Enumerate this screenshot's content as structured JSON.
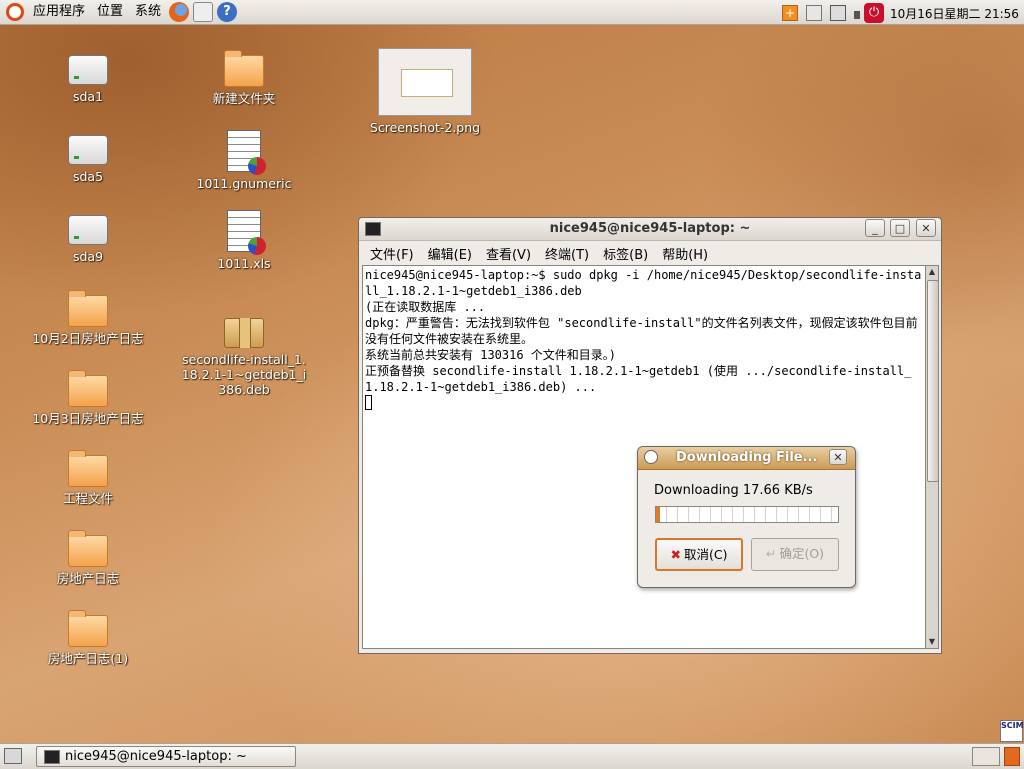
{
  "top_panel": {
    "menus": [
      "应用程序",
      "位置",
      "系统"
    ],
    "launchers": [
      "firefox-icon",
      "mail-icon",
      "help-icon"
    ],
    "tray_icons": [
      "notification-icon",
      "keyboard-icon",
      "network-icon",
      "volume-icon",
      "power-icon"
    ],
    "clock": "10月16日星期二 21:56"
  },
  "desktop": {
    "icons": [
      {
        "label": "sda1",
        "type": "drive"
      },
      {
        "label": "sda5",
        "type": "drive"
      },
      {
        "label": "sda9",
        "type": "drive"
      },
      {
        "label": "10月2日房地产日志",
        "type": "folder"
      },
      {
        "label": "10月3日房地产日志",
        "type": "folder"
      },
      {
        "label": "工程文件",
        "type": "folder"
      },
      {
        "label": "房地产日志",
        "type": "folder"
      },
      {
        "label": "房地产日志(1)",
        "type": "folder"
      },
      {
        "label": "新建文件夹",
        "type": "folder"
      },
      {
        "label": "1011.gnumeric",
        "type": "spreadsheet"
      },
      {
        "label": "1011.xls",
        "type": "spreadsheet"
      },
      {
        "label": "secondlife-install_1.18.2.1-1~getdeb1_i386.deb",
        "type": "package"
      },
      {
        "label": "Screenshot-2.png",
        "type": "image"
      }
    ]
  },
  "terminal": {
    "title": "nice945@nice945-laptop: ~",
    "menu": [
      "文件(F)",
      "编辑(E)",
      "查看(V)",
      "终端(T)",
      "标签(B)",
      "帮助(H)"
    ],
    "output": "nice945@nice945-laptop:~$ sudo dpkg -i /home/nice945/Desktop/secondlife-install_1.18.2.1-1~getdeb1_i386.deb\n(正在读取数据库 ...\ndpkg：严重警告：无法找到软件包 \"secondlife-install\"的文件名列表文件，现假定该软件包目前没有任何文件被安装在系统里。\n系统当前总共安装有 130316 个文件和目录。)\n正预备替换 secondlife-install 1.18.2.1-1~getdeb1 (使用 .../secondlife-install_1.18.2.1-1~getdeb1_i386.deb) ..."
  },
  "dialog": {
    "title": "Downloading File...",
    "status": "Downloading 17.66 KB/s",
    "progress_percent": 2,
    "cancel_label": "取消(C)",
    "ok_label": "确定(O)"
  },
  "bottom_panel": {
    "task_label": "nice945@nice945-laptop: ~"
  },
  "scim": "SCIM",
  "colors": {
    "accent": "#dd4814",
    "desktop": "#c98c55",
    "progress": "#e07b28"
  }
}
